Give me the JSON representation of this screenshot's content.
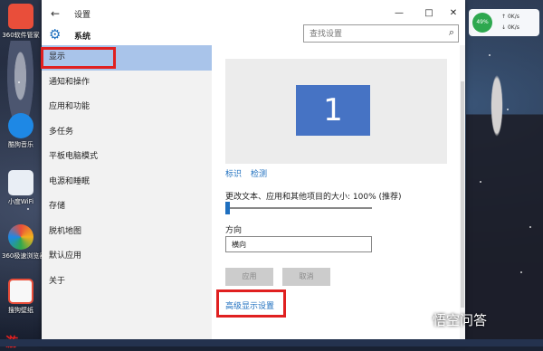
{
  "desktop": {
    "icons": [
      {
        "label": "360软件管家",
        "color": "#e94e3a"
      },
      {
        "label": "酷狗音乐",
        "color": "#1e88e5"
      },
      {
        "label": "小度WiFi",
        "color": "#e9eef5"
      },
      {
        "label": "360极速浏览器",
        "color": "#f2b01e"
      },
      {
        "label": "搜狗壁纸",
        "color": "#f8f8f8"
      }
    ],
    "widget": {
      "percent": "49%",
      "up": "0K/s",
      "down": "0K/s"
    },
    "watermark": "悟空问答",
    "partial_bottom_text": "游"
  },
  "window": {
    "title": "设置",
    "back_icon": "arrow-left-icon",
    "controls": {
      "minimize": "—",
      "maximize": "□",
      "close": "✕"
    },
    "category": "系统",
    "search": {
      "placeholder": "查找设置",
      "value": ""
    }
  },
  "sidebar": {
    "items": [
      {
        "label": "显示",
        "active": true
      },
      {
        "label": "通知和操作"
      },
      {
        "label": "应用和功能"
      },
      {
        "label": "多任务"
      },
      {
        "label": "平板电脑模式"
      },
      {
        "label": "电源和睡眠"
      },
      {
        "label": "存储"
      },
      {
        "label": "脱机地图"
      },
      {
        "label": "默认应用"
      },
      {
        "label": "关于"
      }
    ]
  },
  "main": {
    "monitor_number": "1",
    "identify_link": "标识",
    "detect_link": "检测",
    "scale_label": "更改文本、应用和其他项目的大小: 100% (推荐)",
    "scale_value": 0,
    "orientation_label": "方向",
    "orientation_value": "横向",
    "apply_button": "应用",
    "cancel_button": "取消",
    "advanced_link": "高级显示设置"
  },
  "colors": {
    "accent": "#1e6fbf",
    "active_nav": "#a9c4ea",
    "monitor": "#4673c4",
    "highlight_box": "#e02020"
  }
}
